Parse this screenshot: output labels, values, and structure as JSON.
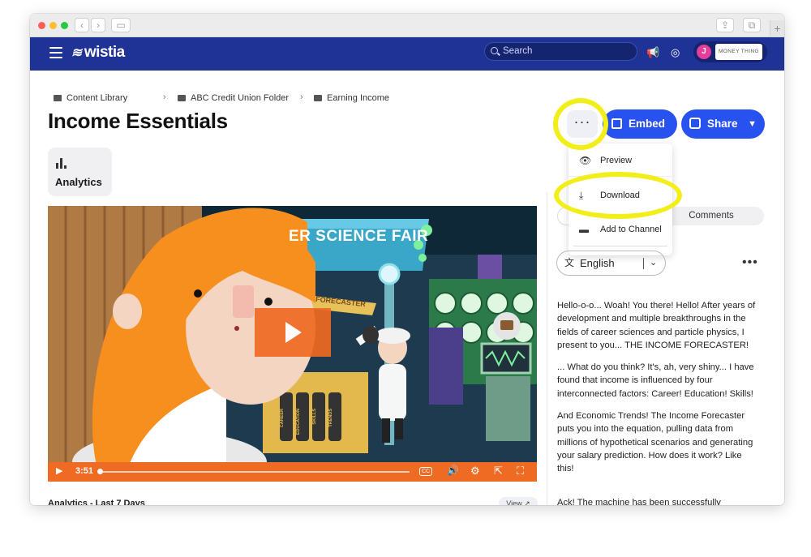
{
  "topbar": {
    "logo": "wistia",
    "search_placeholder": "Search",
    "avatar_initial": "J",
    "brand_chip": "MONEY THING"
  },
  "breadcrumb": [
    {
      "label": "Content Library"
    },
    {
      "label": "ABC Credit Union Folder"
    },
    {
      "label": "Earning Income"
    }
  ],
  "page": {
    "title": "Income Essentials",
    "analytics_label": "Analytics"
  },
  "actions": {
    "more_label": "···",
    "embed_label": "Embed",
    "share_label": "Share"
  },
  "menu": {
    "items": [
      {
        "label": "Preview",
        "icon": "eye-icon"
      },
      {
        "label": "Download",
        "icon": "download-icon"
      },
      {
        "label": "Add to Channel",
        "icon": "channel-icon"
      }
    ]
  },
  "tabs": {
    "comments_label": "Comments"
  },
  "transcript": {
    "language": "English",
    "paragraphs": [
      "Hello-o-o... Woah! You there! Hello! After years of development and multiple breakthroughs in the fields of career sciences and particle physics, I present to you... THE INCOME FORECASTER!",
      "... What do you think? It's, ah, very shiny... I have found that income is influenced by four interconnected factors: Career! Education! Skills!",
      "And Economic Trends! The Income Forecaster puts you into the equation, pulling data from millions of hypothetical scenarios and generating your salary prediction. How does it work? Like this!"
    ],
    "truncated": "Ack! The machine has been successfully"
  },
  "video": {
    "duration": "3:51",
    "banner": "ER SCIENCE FAIR",
    "sign": "FORECASTER",
    "cans": [
      "CAREER",
      "EDUCATION",
      "SKILLS",
      "TRENDS"
    ],
    "progress": 0.0
  },
  "below": {
    "section_title": "Analytics - Last 7 Days",
    "view_label": "View ↗"
  },
  "colors": {
    "topbar": "#1e3395",
    "accent": "#2852f0",
    "video_orange": "#ef6a22",
    "highlight_ring": "#f2ee18"
  }
}
